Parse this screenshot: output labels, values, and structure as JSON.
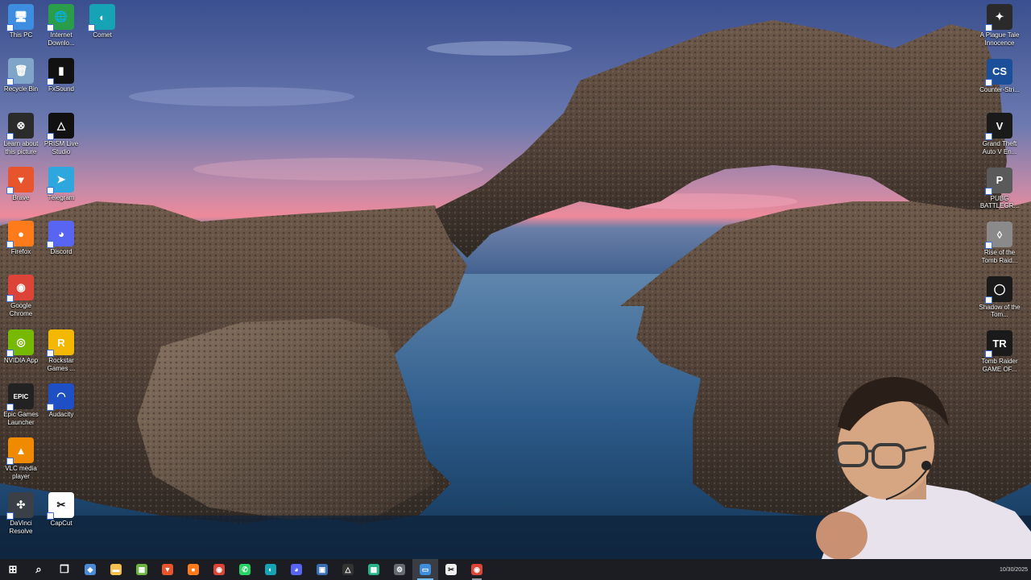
{
  "desktop_left": [
    {
      "name": "this-pc",
      "label": "This PC",
      "color": "#3d8de0",
      "glyph": "🖥"
    },
    {
      "name": "internet-download-manager",
      "label": "Internet Downlo...",
      "color": "#2a9d4a",
      "glyph": "🌐"
    },
    {
      "name": "comet",
      "label": "Comet",
      "color": "#15a3b5",
      "glyph": "◐"
    },
    {
      "name": "recycle-bin",
      "label": "Recycle Bin",
      "color": "#7fa6c8",
      "glyph": "🗑"
    },
    {
      "name": "fxsound",
      "label": "FxSound",
      "color": "#111111",
      "glyph": "▮"
    },
    {
      "name": "learn-about-picture",
      "label": "Learn about this picture",
      "color": "#2b2b2b",
      "glyph": "⊗"
    },
    {
      "name": "prism-live-studio",
      "label": "PRISM Live Studio",
      "color": "#111111",
      "glyph": "△"
    },
    {
      "name": "brave",
      "label": "Brave",
      "color": "#e8542b",
      "glyph": "▼"
    },
    {
      "name": "telegram",
      "label": "Telegram",
      "color": "#2ea6de",
      "glyph": "➤"
    },
    {
      "name": "firefox",
      "label": "Firefox",
      "color": "#ff7a1a",
      "glyph": "●"
    },
    {
      "name": "discord",
      "label": "Discord",
      "color": "#5865f2",
      "glyph": "◕"
    },
    {
      "name": "google-chrome",
      "label": "Google Chrome",
      "color": "#dd4437",
      "glyph": "◉"
    },
    {
      "name": "nvidia-app",
      "label": "NVIDIA App",
      "color": "#76b900",
      "glyph": "◎"
    },
    {
      "name": "rockstar-games",
      "label": "Rockstar Games ...",
      "color": "#f5b800",
      "glyph": "R"
    },
    {
      "name": "epic-games",
      "label": "Epic Games Launcher",
      "color": "#222222",
      "glyph": "EPIC"
    },
    {
      "name": "audacity",
      "label": "Audacity",
      "color": "#1f4fc4",
      "glyph": "◠"
    },
    {
      "name": "vlc",
      "label": "VLC media player",
      "color": "#f08a00",
      "glyph": "▲"
    },
    {
      "name": "davinci-resolve",
      "label": "DaVinci Resolve",
      "color": "#3a3f48",
      "glyph": "✣"
    },
    {
      "name": "capcut",
      "label": "CapCut",
      "color": "#ffffff",
      "glyph": "✂"
    }
  ],
  "desktop_right": [
    {
      "name": "a-plague-tale",
      "label": "A Plague Tale Innocence",
      "color": "#2a2a2a",
      "glyph": "✦"
    },
    {
      "name": "counter-strike",
      "label": "Counter-Stri...",
      "color": "#1b4f9a",
      "glyph": "CS"
    },
    {
      "name": "gta-v",
      "label": "Grand Theft Auto V En...",
      "color": "#1a1a1a",
      "glyph": "V"
    },
    {
      "name": "pubg",
      "label": "PUBG BATTLEGR...",
      "color": "#5a5a5a",
      "glyph": "P"
    },
    {
      "name": "rise-tomb-raider",
      "label": "Rise of the Tomb Raid...",
      "color": "#8a8a8a",
      "glyph": "◊"
    },
    {
      "name": "shadow-tomb-raider",
      "label": "Shadow of the Tom...",
      "color": "#1a1a1a",
      "glyph": "◯"
    },
    {
      "name": "tomb-raider-goty",
      "label": "Tomb Raider GAME OF...",
      "color": "#1a1a1a",
      "glyph": "TR"
    }
  ],
  "taskbar": [
    {
      "name": "start",
      "glyph": "⊞",
      "color": "#ffffff",
      "state": ""
    },
    {
      "name": "search",
      "glyph": "⌕",
      "color": "#ffffff",
      "state": ""
    },
    {
      "name": "task-view",
      "glyph": "❐",
      "color": "#ffffff",
      "state": ""
    },
    {
      "name": "copilot",
      "glyph": "◆",
      "color": "#4a8bd8",
      "state": ""
    },
    {
      "name": "file-explorer",
      "glyph": "▬",
      "color": "#f2c14e",
      "state": ""
    },
    {
      "name": "store",
      "glyph": "▦",
      "color": "#6cb33f",
      "state": ""
    },
    {
      "name": "brave",
      "glyph": "▼",
      "color": "#e8542b",
      "state": ""
    },
    {
      "name": "firefox",
      "glyph": "●",
      "color": "#ff7a1a",
      "state": ""
    },
    {
      "name": "chrome",
      "glyph": "◉",
      "color": "#dd4437",
      "state": ""
    },
    {
      "name": "whatsapp",
      "glyph": "✆",
      "color": "#25d366",
      "state": ""
    },
    {
      "name": "comet",
      "glyph": "◐",
      "color": "#15a3b5",
      "state": ""
    },
    {
      "name": "discord",
      "glyph": "◕",
      "color": "#5865f2",
      "state": ""
    },
    {
      "name": "app-blue",
      "glyph": "▣",
      "color": "#3b6fb5",
      "state": ""
    },
    {
      "name": "prism",
      "glyph": "△",
      "color": "#333333",
      "state": ""
    },
    {
      "name": "app-green",
      "glyph": "▩",
      "color": "#27b38a",
      "state": ""
    },
    {
      "name": "settings",
      "glyph": "⚙",
      "color": "#666a72",
      "state": ""
    },
    {
      "name": "active-window",
      "glyph": "▭",
      "color": "#3d8de0",
      "state": "active"
    },
    {
      "name": "capcut",
      "glyph": "✂",
      "color": "#eeeeee",
      "state": ""
    },
    {
      "name": "chrome-2",
      "glyph": "◉",
      "color": "#dd4437",
      "state": "open"
    }
  ],
  "clock": {
    "date": "10/30/2025"
  }
}
